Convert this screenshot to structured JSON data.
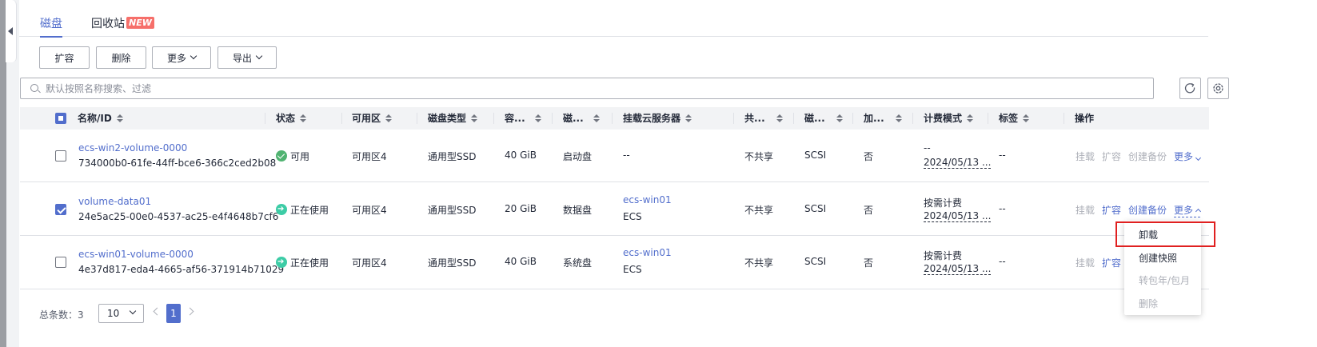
{
  "tabs": [
    {
      "label": "磁盘",
      "active": true
    },
    {
      "label": "回收站",
      "badge": "NEW",
      "active": false
    }
  ],
  "toolbar": {
    "expand": "扩容",
    "delete": "删除",
    "more": "更多",
    "export": "导出"
  },
  "search": {
    "placeholder": "默认按照名称搜索、过滤"
  },
  "table": {
    "headers": {
      "name": "名称/ID",
      "status": "状态",
      "az": "可用区",
      "disk_type": "磁盘类型",
      "capacity": "容...",
      "attr": "磁...",
      "server": "挂载云服务器",
      "share": "共...",
      "mode": "磁...",
      "encrypt": "加...",
      "billing": "计费模式",
      "tags": "标签",
      "ops": "操作"
    },
    "rows": [
      {
        "name": "ecs-win2-volume-0000",
        "id": "734000b0-61fe-44ff-bce6-366c2ced2b08",
        "status": "可用",
        "az": "可用区4",
        "disk_type": "通用型SSD",
        "capacity": "40 GiB",
        "attr": "启动盘",
        "server": "--",
        "server_sub": "",
        "share": "不共享",
        "mode": "SCSI",
        "encrypt": "否",
        "billing": "--",
        "billing_date": "2024/05/13 ...",
        "tags": "--",
        "op_attach": "挂载",
        "op_expand": "扩容",
        "op_backup": "创建备份",
        "op_more": "更多"
      },
      {
        "name": "volume-data01",
        "id": "24e5ac25-00e0-4537-ac25-e4f4648b7cf6",
        "status": "正在使用",
        "az": "可用区4",
        "disk_type": "通用型SSD",
        "capacity": "20 GiB",
        "attr": "数据盘",
        "server": "ecs-win01",
        "server_sub": "ECS",
        "share": "不共享",
        "mode": "SCSI",
        "encrypt": "否",
        "billing": "按需计费",
        "billing_date": "2024/05/13 ...",
        "tags": "--",
        "op_attach": "挂载",
        "op_expand": "扩容",
        "op_backup": "创建备份",
        "op_more": "更多"
      },
      {
        "name": "ecs-win01-volume-0000",
        "id": "4e37d817-eda4-4665-af56-371914b71029",
        "status": "正在使用",
        "az": "可用区4",
        "disk_type": "通用型SSD",
        "capacity": "40 GiB",
        "attr": "系统盘",
        "server": "ecs-win01",
        "server_sub": "ECS",
        "share": "不共享",
        "mode": "SCSI",
        "encrypt": "否",
        "billing": "按需计费",
        "billing_date": "2024/05/13 ...",
        "tags": "--",
        "op_attach": "挂载",
        "op_expand": "扩容"
      }
    ]
  },
  "dropdown": {
    "items": [
      "卸载",
      "创建快照",
      "转包年/包月",
      "删除"
    ]
  },
  "pagination": {
    "total_label": "总条数：3",
    "page_size": "10",
    "current_page": "1"
  },
  "colors": {
    "primary": "#526ecc",
    "status_available": "#50b371",
    "status_in_use": "#3dcca6",
    "highlight": "#e02020"
  }
}
